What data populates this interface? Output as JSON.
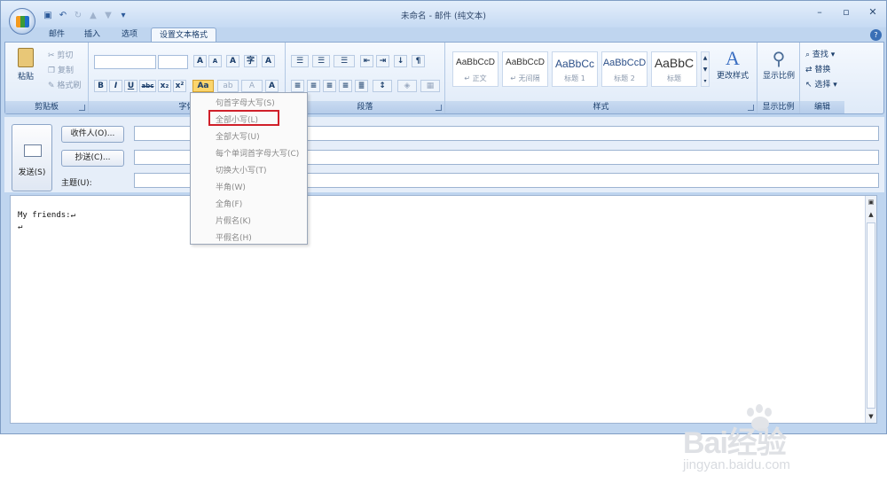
{
  "window": {
    "title": "未命名 - 邮件 (纯文本)",
    "min": "–",
    "max": "▫",
    "close": "✕"
  },
  "qat": {
    "save": "▣",
    "undo": "↶",
    "redo": "↻",
    "up": "▲",
    "down": "▼",
    "more": "▾"
  },
  "tabs": [
    "邮件",
    "插入",
    "选项",
    "设置文本格式"
  ],
  "ribbon": {
    "clipboard": {
      "label": "剪贴板",
      "paste": "粘贴",
      "cut": "剪切",
      "copy": "复制",
      "painter": "格式刷"
    },
    "font": {
      "label": "字体",
      "bold": "B",
      "italic": "I",
      "underline": "U",
      "strike": "abc",
      "sub": "x₂",
      "sup": "x²",
      "case": "Aa",
      "grow": "A",
      "shrink": "A",
      "clear": "A"
    },
    "paragraph": {
      "label": "段落"
    },
    "styles": {
      "label": "样式",
      "items": [
        {
          "preview": "AaBbCcD",
          "name": "↵ 正文"
        },
        {
          "preview": "AaBbCcD",
          "name": "↵ 无间隔"
        },
        {
          "preview": "AaBbCc",
          "name": "标题 1"
        },
        {
          "preview": "AaBbCcD",
          "name": "标题 2"
        },
        {
          "preview": "AaBbC",
          "name": "标题"
        }
      ],
      "change": "更改样式"
    },
    "zoom": {
      "label": "显示比例",
      "button": "显示比例"
    },
    "editing": {
      "label": "编辑",
      "find": "查找 ▾",
      "replace": "替换",
      "select": "选择 ▾"
    }
  },
  "header": {
    "send": "发送(S)",
    "to": "收件人(O)...",
    "cc": "抄送(C)...",
    "subject": "主题(U):"
  },
  "body": {
    "line1": "My friends:↵",
    "line2": "↵"
  },
  "case_menu": {
    "items": [
      "句首字母大写(S)",
      "全部小写(L)",
      "全部大写(U)",
      "每个单词首字母大写(C)",
      "切换大小写(T)",
      "半角(W)",
      "全角(F)",
      "片假名(K)",
      "平假名(H)"
    ],
    "highlighted_index": 1,
    "highlight_color": "#d0202a"
  },
  "watermark": {
    "brand": "Bai经验",
    "url": "jingyan.baidu.com"
  }
}
